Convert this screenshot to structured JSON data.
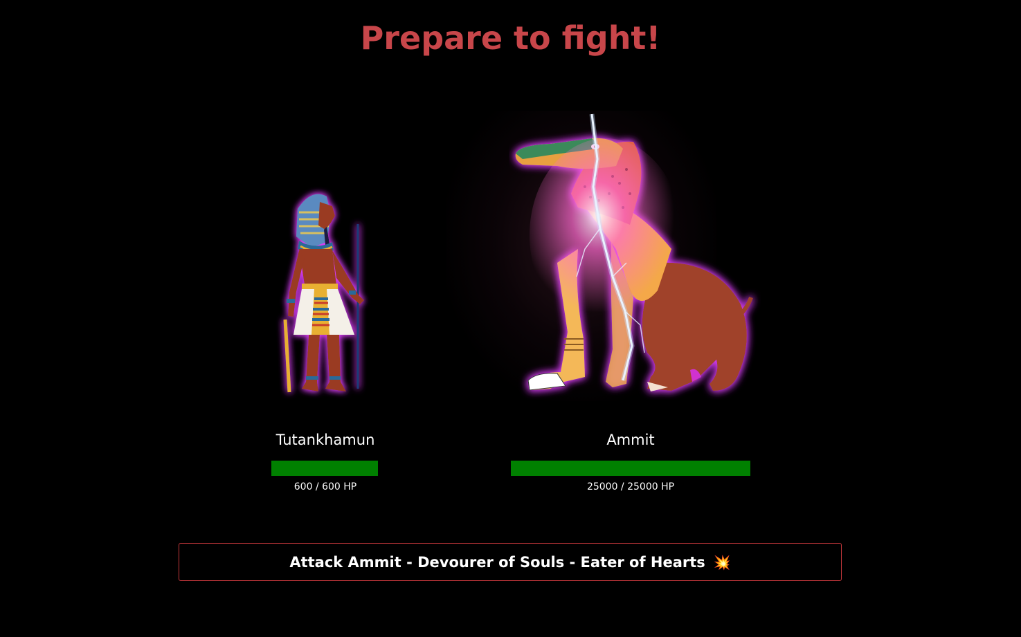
{
  "header": {
    "title": "Prepare to fight!"
  },
  "player": {
    "name": "Tutankhamun",
    "hp_current": 600,
    "hp_max": 600,
    "hp_text": "600 / 600 HP",
    "hp_fraction": 1.0,
    "icon": "pharaoh-figure"
  },
  "boss": {
    "name": "Ammit",
    "hp_current": 25000,
    "hp_max": 25000,
    "hp_text": "25000 / 25000 HP",
    "hp_fraction": 1.0,
    "icon": "ammit-figure",
    "effect": "lightning"
  },
  "actions": {
    "attack_label": "Attack Ammit - Devourer of Souls - Eater of Hearts",
    "attack_icon": "💥"
  },
  "colors": {
    "title": "#c8464a",
    "hp_fill": "#008000",
    "button_border": "#c8383c",
    "glow": "#e040ff"
  }
}
